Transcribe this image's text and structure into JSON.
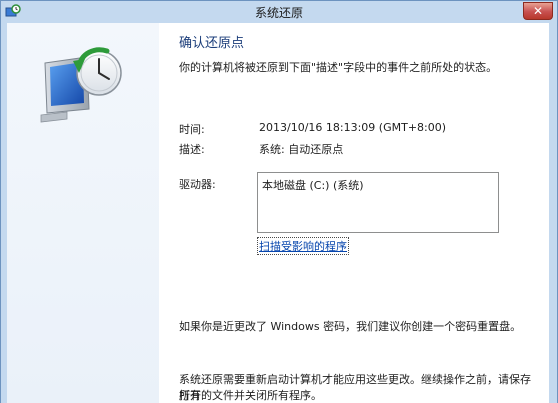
{
  "window": {
    "title": "系统还原",
    "close_glyph": "✕"
  },
  "content": {
    "heading": "确认还原点",
    "intro": "你的计算机将被还原到下面\"描述\"字段中的事件之前所处的状态。",
    "time_label": "时间:",
    "time_value": "2013/10/16 18:13:09 (GMT+8:00)",
    "description_label": "描述:",
    "description_value": "系统: 自动还原点",
    "drives_label": "驱动器:",
    "drives": [
      "本地磁盘 (C:) (系统)"
    ],
    "scan_link": "扫描受影响的程序",
    "password_note": "如果你是近更改了 Windows 密码，我们建议你创建一个密码重置盘。",
    "restart_note_line1": "系统还原需要重新启动计算机才能应用这些更改。继续操作之前，请保存所有",
    "restart_note_line2": "打开的文件并关闭所有程序。"
  },
  "icons": {
    "title_icon": "system-restore-icon",
    "hero_icon": "system-restore-computer-clock-icon"
  },
  "colors": {
    "frame": "#c4d9ef",
    "heading": "#1b3d7a",
    "link": "#0645ad",
    "close": "#c75050"
  }
}
